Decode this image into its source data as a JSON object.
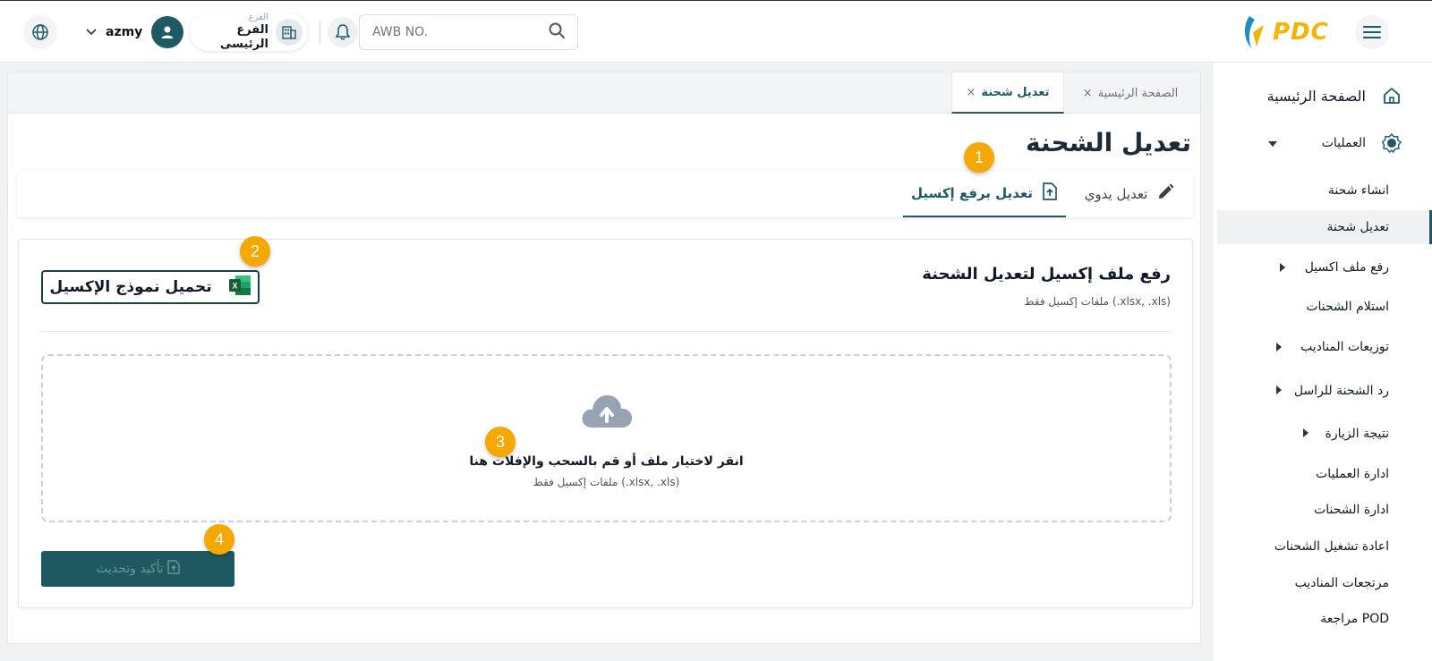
{
  "header": {
    "logo_text": "PDC",
    "search_placeholder": "AWB NO.",
    "branch_label": "الفرع",
    "branch_name": "الفرع الرئيسى",
    "username": "azmy"
  },
  "tabs": [
    {
      "label": "الصفحة الرئيسية",
      "close": "×"
    },
    {
      "label": "تعديل شحنة",
      "close": "×"
    }
  ],
  "page_title": "تعديل الشحنة",
  "modes": {
    "manual": "تعديل يدوي",
    "excel": "تعديل برفع إكسيل"
  },
  "upload": {
    "title": "رفع ملف إكسيل لتعديل الشحنة",
    "subtitle": "ملفات إكسيل فقط (.xlsx, .xls)",
    "template_button": "تحميل نموذج الإكسيل",
    "excel_icon_letter": "X",
    "drop_main": "انقر لاختيار ملف أو قم بالسحب والإفلات هنا",
    "drop_sub": "ملفات إكسيل فقط (.xlsx, .xls)",
    "confirm_button": "تأكيد وتحديث"
  },
  "badges": [
    "1",
    "2",
    "3",
    "4"
  ],
  "sidebar": {
    "home": "الصفحة الرئيسية",
    "operations": "العمليات",
    "items": [
      "انشاء شحنة",
      "تعديل شحنة",
      "رفع ملف اكسيل",
      "استلام الشحنات",
      "توزيعات المناديب",
      "رد الشحنة للراسل",
      "نتيجة الزيارة",
      "ادارة العمليات",
      "ادارة الشحنات",
      "اعادة تشغيل الشحنات",
      "مرتجعات المناديب",
      "مراجعة POD"
    ]
  },
  "colors": {
    "primary": "#1d5a63",
    "accent": "#f5a800",
    "logo": "#f5b400"
  }
}
